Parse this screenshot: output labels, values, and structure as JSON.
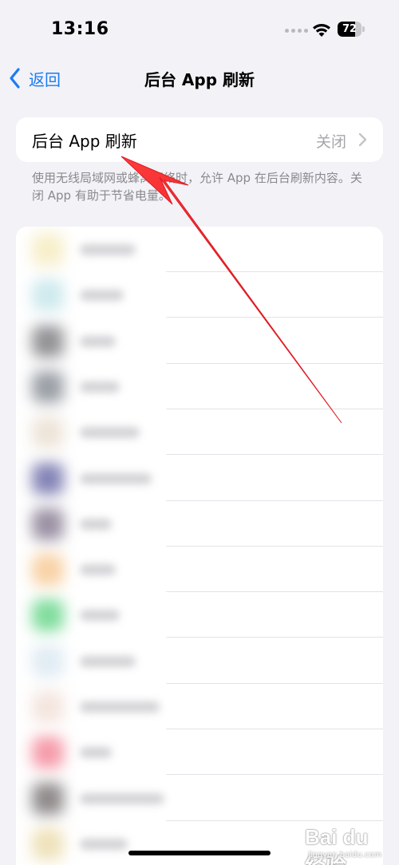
{
  "status_bar": {
    "time": "13:16",
    "battery_level": "72",
    "battery_fraction": 0.72,
    "icons": [
      "signal-dots-icon",
      "wifi-icon",
      "battery-icon"
    ]
  },
  "nav": {
    "back_label": "返回",
    "title": "后台 App 刷新"
  },
  "main_setting": {
    "label": "后台 App 刷新",
    "value": "关闭"
  },
  "footnote": "使用无线局域网或蜂窝网络时，允许 App 在后台刷新内容。关闭 App 有助于节省电量。",
  "app_list": {
    "rows": [
      {
        "icon_color": "#f5e9b8",
        "name_width": 70
      },
      {
        "icon_color": "#bfe3e8",
        "name_width": 55
      },
      {
        "icon_color": "#6f6f74",
        "name_width": 45
      },
      {
        "icon_color": "#7a8089",
        "name_width": 50
      },
      {
        "icon_color": "#e8dccd",
        "name_width": 75
      },
      {
        "icon_color": "#5c5c9e",
        "name_width": 90
      },
      {
        "icon_color": "#7a6d86",
        "name_width": 40
      },
      {
        "icon_color": "#f6c489",
        "name_width": 45
      },
      {
        "icon_color": "#57d17d",
        "name_width": 50
      },
      {
        "icon_color": "#d7e6f0",
        "name_width": 70
      },
      {
        "icon_color": "#f1ddd4",
        "name_width": 100
      },
      {
        "icon_color": "#f27c8f",
        "name_width": 40
      },
      {
        "icon_color": "#6b6565",
        "name_width": 105
      },
      {
        "icon_color": "#ead9a5",
        "name_width": 60
      }
    ]
  },
  "colors": {
    "accent": "#1a7cf5",
    "annotation_arrow": "#e01b24"
  },
  "watermark": {
    "logo": "Bai du 经验",
    "sub": "jingyan.baidu.com"
  }
}
